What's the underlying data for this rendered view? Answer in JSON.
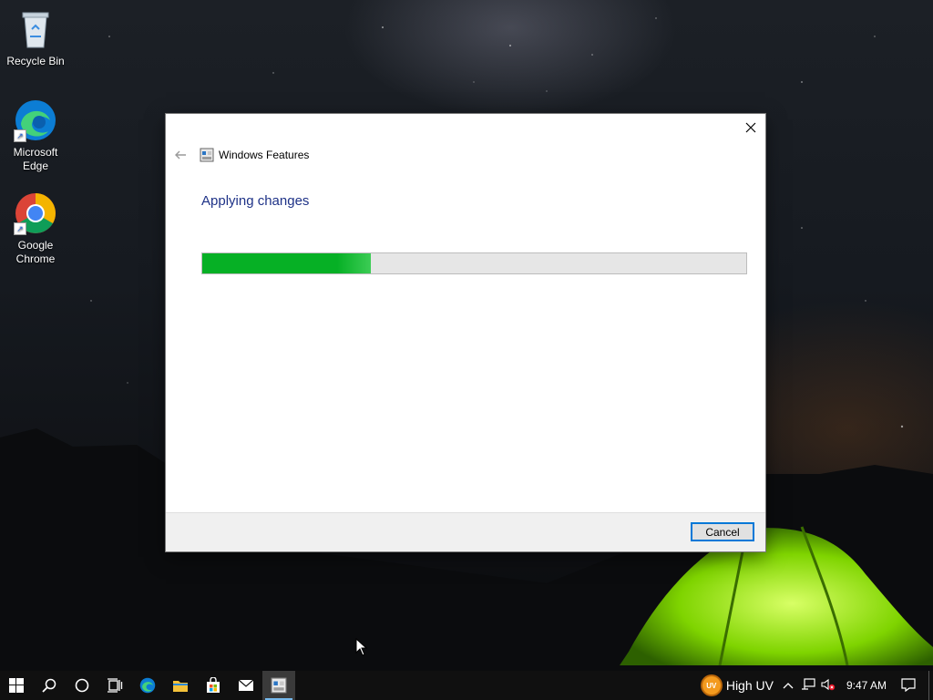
{
  "desktop": {
    "icons": [
      {
        "label": "Recycle Bin"
      },
      {
        "label": "Microsoft Edge"
      },
      {
        "label": "Google Chrome"
      }
    ]
  },
  "dialog": {
    "title": "Windows Features",
    "heading": "Applying changes",
    "progress_percent": 31,
    "cancel_label": "Cancel"
  },
  "taskbar": {
    "weather_label": "High UV",
    "weather_badge": "UV",
    "time": "9:47 AM",
    "pinned": [
      "start-icon",
      "search-icon",
      "cortana-icon",
      "task-view-icon",
      "edge-icon",
      "file-explorer-icon",
      "store-icon",
      "mail-icon",
      "windows-features-icon"
    ]
  },
  "colors": {
    "accent": "#0078d7",
    "progress": "#06b025",
    "heading": "#1e3287"
  }
}
